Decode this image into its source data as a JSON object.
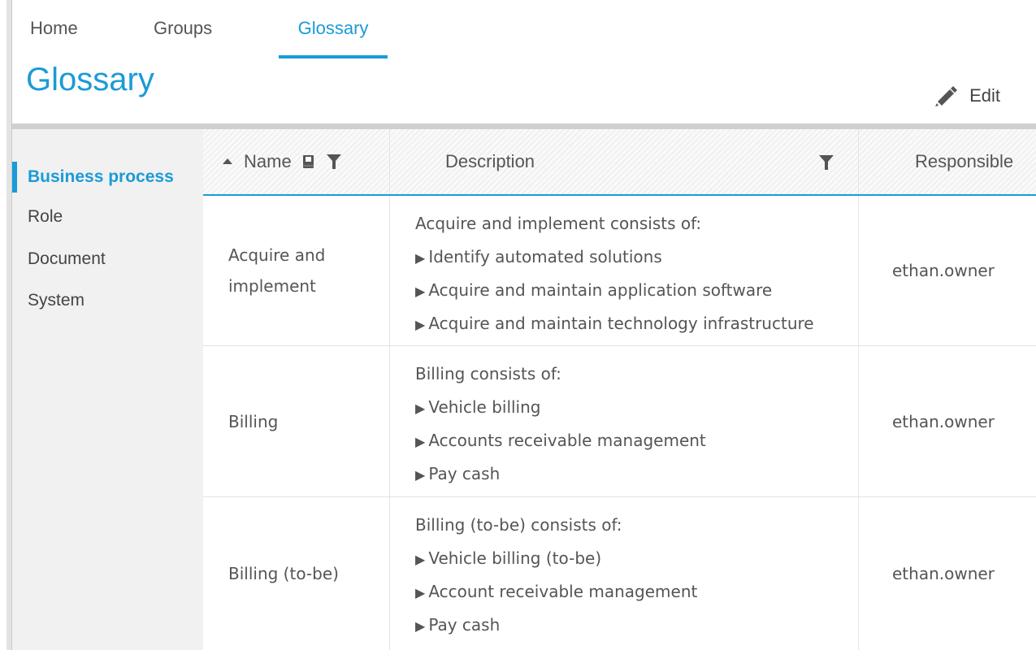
{
  "nav": {
    "tabs": [
      {
        "label": "Home"
      },
      {
        "label": "Groups"
      },
      {
        "label": "Glossary"
      }
    ],
    "active": "Glossary"
  },
  "header": {
    "title": "Glossary",
    "edit_label": "Edit"
  },
  "sidebar": {
    "items": [
      {
        "label": "Business process"
      },
      {
        "label": "Role"
      },
      {
        "label": "Document"
      },
      {
        "label": "System"
      }
    ],
    "active": "Business process"
  },
  "table": {
    "columns": [
      {
        "label": "Name"
      },
      {
        "label": "Description"
      },
      {
        "label": "Responsible"
      }
    ],
    "rows": [
      {
        "name": "Acquire and implement",
        "description": {
          "intro": "Acquire and implement consists of:",
          "items": [
            "Identify automated solutions",
            "Acquire and maintain application software",
            "Acquire and maintain technology infrastructure"
          ]
        },
        "responsible": "ethan.owner"
      },
      {
        "name": "Billing",
        "description": {
          "intro": "Billing consists of:",
          "items": [
            "Vehicle billing",
            "Accounts receivable management",
            "Pay cash"
          ]
        },
        "responsible": "ethan.owner"
      },
      {
        "name": "Billing (to-be)",
        "description": {
          "intro": "Billing (to-be) consists of:",
          "items": [
            "Vehicle billing (to-be)",
            "Account receivable management",
            "Pay cash"
          ]
        },
        "responsible": "ethan.owner"
      }
    ]
  },
  "icons": {
    "edit": "pencil-icon",
    "sort": "sort-ascending-icon",
    "book": "book-icon",
    "filter": "filter-icon",
    "bullet": "triangle-right-icon"
  },
  "colors": {
    "accent": "#1a9bd7"
  }
}
